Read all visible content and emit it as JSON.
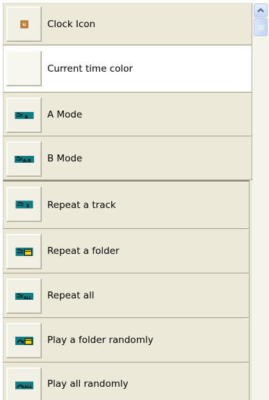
{
  "items": [
    {
      "label": "Clock Icon",
      "icon": "clock-icon"
    },
    {
      "label": "Current time color",
      "icon": "color-swatch"
    },
    {
      "label": "A Mode",
      "icon": "a-mode-icon"
    },
    {
      "label": "B Mode",
      "icon": "b-mode-icon"
    },
    {
      "label": "Repeat a track",
      "icon": "repeat-track-icon"
    },
    {
      "label": "Repeat a folder",
      "icon": "repeat-folder-icon"
    },
    {
      "label": "Repeat all",
      "icon": "repeat-all-icon"
    },
    {
      "label": "Play a folder randomly",
      "icon": "random-folder-icon"
    },
    {
      "label": "Play all randomly",
      "icon": "random-all-icon"
    }
  ],
  "colors": {
    "panel": "#ece9d8",
    "icon_teal": "#0e7d84",
    "clock_orange": "#e07a1c",
    "folder_yellow": "#ffd700",
    "current_time_swatch": "#f7f6ef"
  }
}
